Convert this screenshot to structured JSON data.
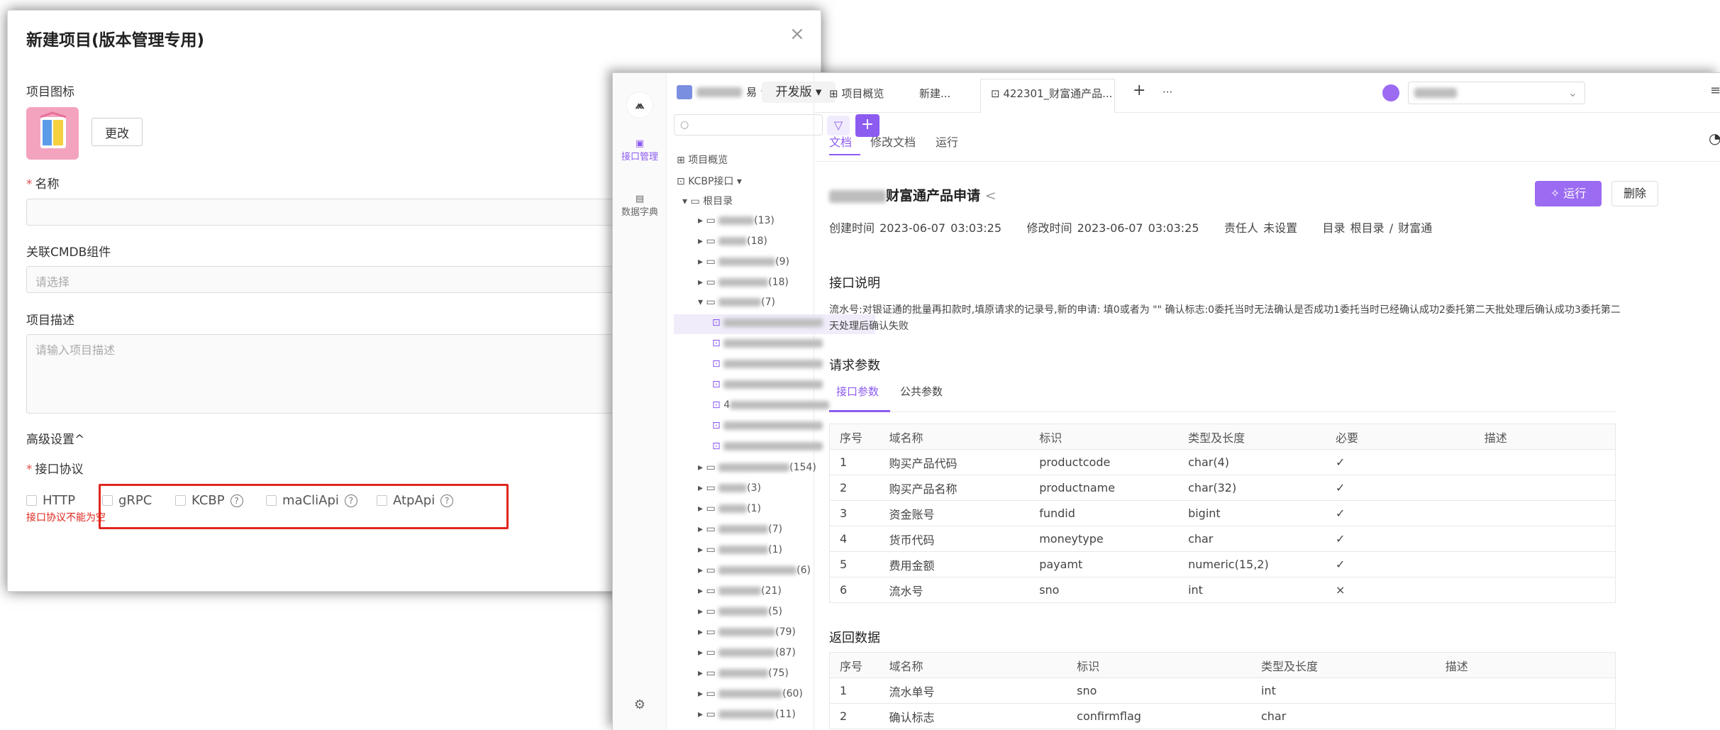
{
  "modal": {
    "title": "新建项目(版本管理专用)",
    "close": "×",
    "icon_label": "项目图标",
    "change_btn": "更改",
    "name_label": "名称",
    "cmdb_label": "关联CMDB组件",
    "cmdb_placeholder": "请选择",
    "desc_label": "项目描述",
    "desc_placeholder": "请输入项目描述",
    "advanced": "高级设置^",
    "protocol_label": "接口协议",
    "protocols": [
      "HTTP",
      "gRPC",
      "KCBP",
      "maCliApi",
      "AtpApi"
    ],
    "error": "接口协议不能为空"
  },
  "app": {
    "rail": {
      "api_mgmt": "接口管理",
      "data_dict": "数据字典"
    },
    "tree": {
      "project_ws_suffix": "易",
      "env": "开发版",
      "overview": "项目概览",
      "kcbp": "KCBP接口",
      "root": "根目录",
      "folders": [
        "(13)",
        "(18)",
        "(9)",
        "(18)",
        "(7)",
        "(154)",
        "(3)",
        "(1)",
        "(7)",
        "(1)",
        "(6)",
        "(21)",
        "(5)",
        "(79)",
        "(87)",
        "(75)",
        "(60)",
        "(11)"
      ],
      "item_prefix": "4"
    },
    "tabs": [
      "项目概览",
      "新建...",
      "422301_财富通产品...",
      "+",
      "···"
    ],
    "subtabs": [
      "文档",
      "修改文档",
      "运行"
    ],
    "header": {
      "title_suffix": "财富通产品申请",
      "run": "运行",
      "delete": "删除",
      "created_label": "创建时间",
      "created": "2023-06-07 03:03:25",
      "modified_label": "修改时间",
      "modified": "2023-06-07 03:03:25",
      "owner_label": "责任人",
      "owner": "未设置",
      "dir_label": "目录",
      "dir": "根目录 / 财富通"
    },
    "api_desc_title": "接口说明",
    "api_desc": "流水号:对银证通的批量再扣款时,填原请求的记录号,新的申请: 填0或者为 \"\" 确认标志:0委托当时无法确认是否成功1委托当时已经确认成功2委托第二天批处理后确认成功3委托第二天处理后确认失败",
    "req_title": "请求参数",
    "req_tabs": [
      "接口参数",
      "公共参数"
    ],
    "req_headers": [
      "序号",
      "域名称",
      "标识",
      "类型及长度",
      "必要",
      "描述"
    ],
    "req_rows": [
      [
        "1",
        "购买产品代码",
        "productcode",
        "char(4)",
        "✓",
        ""
      ],
      [
        "2",
        "购买产品名称",
        "productname",
        "char(32)",
        "✓",
        ""
      ],
      [
        "3",
        "资金账号",
        "fundid",
        "bigint",
        "✓",
        ""
      ],
      [
        "4",
        "货币代码",
        "moneytype",
        "char",
        "✓",
        ""
      ],
      [
        "5",
        "费用金额",
        "payamt",
        "numeric(15,2)",
        "✓",
        ""
      ],
      [
        "6",
        "流水号",
        "sno",
        "int",
        "×",
        ""
      ]
    ],
    "resp_title": "返回数据",
    "resp_headers": [
      "序号",
      "域名称",
      "标识",
      "类型及长度",
      "描述"
    ],
    "resp_rows": [
      [
        "1",
        "流水单号",
        "sno",
        "int",
        ""
      ],
      [
        "2",
        "确认标志",
        "confirmflag",
        "char",
        ""
      ]
    ]
  },
  "colors": {
    "accent": "#8c5bf0",
    "error": "#e0271f"
  }
}
